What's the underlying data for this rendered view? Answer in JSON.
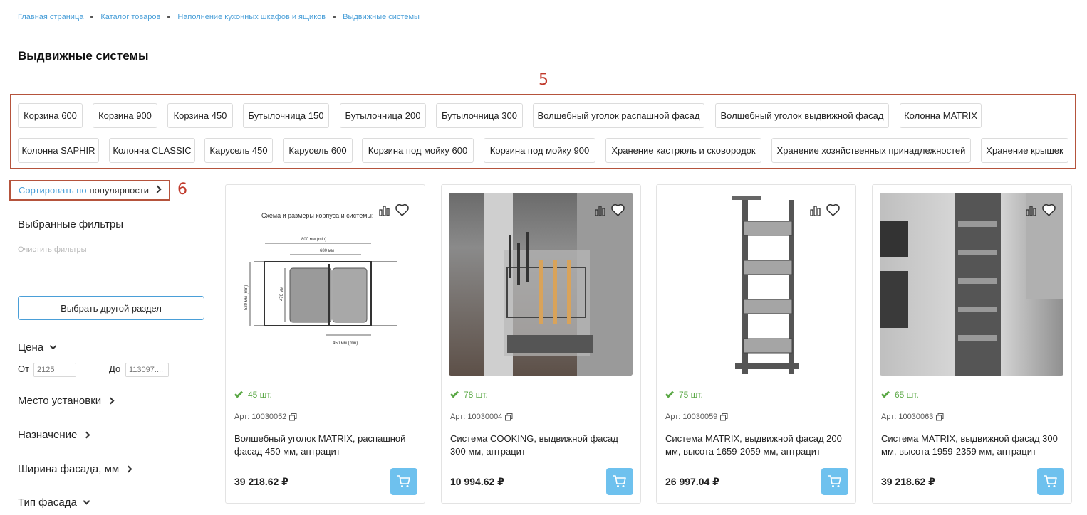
{
  "breadcrumb": [
    "Главная страница",
    "Каталог товаров",
    "Наполнение кухонных шкафов и ящиков",
    "Выдвижные системы"
  ],
  "page_title": "Выдвижные системы",
  "annotations": {
    "tags_marker": "5",
    "sort_marker": "6"
  },
  "tags_row1": [
    "Корзина 600",
    "Корзина 900",
    "Корзина 450",
    "Бутылочница 150",
    "Бутылочница 200",
    "Бутылочница 300",
    "Волшебный уголок распашной фасад",
    "Волшебный уголок выдвижной фасад",
    "Колонна MATRIX"
  ],
  "tags_row2": [
    "Колонна SAPHIR",
    "Колонна CLASSIC",
    "Карусель 450",
    "Карусель 600",
    "Корзина под мойку 600",
    "Корзина под мойку 900",
    "Хранение кастрюль и сковородок",
    "Хранение хозяйственных принадлежностей",
    "Хранение крышек"
  ],
  "sort": {
    "prefix": "Сортировать по",
    "value": "популярности"
  },
  "sidebar": {
    "selected_filters_title": "Выбранные фильтры",
    "clear_filters": "Очистить фильтры",
    "choose_section": "Выбрать другой раздел",
    "price": {
      "title": "Цена",
      "from_label": "От",
      "from_placeholder": "2125",
      "to_label": "До",
      "to_placeholder": "113097...."
    },
    "filters": [
      "Место установки",
      "Назначение",
      "Ширина фасада, мм",
      "Тип фасада"
    ]
  },
  "products": [
    {
      "stock": "45 шт.",
      "art": "Арт: 10030052",
      "name": "Волшебный уголок MATRIX, распашной фасад 450 мм, антрацит",
      "price": "39 218.62 ₽",
      "diagram": {
        "title": "Схема и размеры корпуса и системы:",
        "dim1": "800 мм (min)",
        "dim2": "680 мм",
        "dim3": "520 мм (min)",
        "dim4": "470 мм",
        "dim5": "450 мм (min)"
      }
    },
    {
      "stock": "78 шт.",
      "art": "Арт: 10030004",
      "name": "Система COOKING, выдвижной фасад 300 мм, антрацит",
      "price": "10 994.62 ₽"
    },
    {
      "stock": "75 шт.",
      "art": "Арт: 10030059",
      "name": "Система MATRIX, выдвижной фасад 200 мм, высота 1659-2059 мм, антрацит",
      "price": "26 997.04 ₽"
    },
    {
      "stock": "65 шт.",
      "art": "Арт: 10030063",
      "name": "Система MATRIX, выдвижной фасад 300 мм, высота 1959-2359 мм, антрацит",
      "price": "39 218.62 ₽"
    }
  ],
  "colors": {
    "accent": "#4a9fd8",
    "cart": "#6ec1ee",
    "stock": "#5aa845",
    "annotation": "#b5533c"
  }
}
